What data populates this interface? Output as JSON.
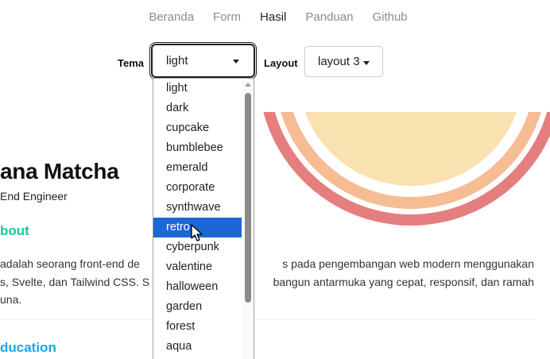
{
  "nav": {
    "items": [
      {
        "label": "Beranda",
        "active": false
      },
      {
        "label": "Form",
        "active": false
      },
      {
        "label": "Hasil",
        "active": true
      },
      {
        "label": "Panduan",
        "active": false
      },
      {
        "label": "Github",
        "active": false
      }
    ]
  },
  "controls": {
    "tema_label": "Tema",
    "tema_value": "light",
    "layout_label": "Layout",
    "layout_value": "layout 3"
  },
  "dropdown": {
    "options": [
      "light",
      "dark",
      "cupcake",
      "bumblebee",
      "emerald",
      "corporate",
      "synthwave",
      "retro",
      "cyberpunk",
      "valentine",
      "halloween",
      "garden",
      "forest",
      "aqua"
    ],
    "highlighted": "retro"
  },
  "profile": {
    "name": "ana Matcha",
    "role": "End Engineer",
    "about_title": "bout",
    "about_text_line1": "adalah seorang front-end de",
    "about_text_line1b": "s pada pengembangan web modern menggunakan",
    "about_text_line2": "s, Svelte, dan Tailwind CSS. S",
    "about_text_line2b": "bangun antarmuka yang cepat, responsif, dan ramah",
    "about_text_line3": "una.",
    "education_title": "ducation"
  },
  "colors": {
    "arc_outer": "#e57e7e",
    "arc_middle": "#f6bc93",
    "arc_inner": "#f9e1b0",
    "about_accent": "#1bc69c",
    "education_accent": "#1aa7e8",
    "selected_option": "#1b67d3"
  }
}
